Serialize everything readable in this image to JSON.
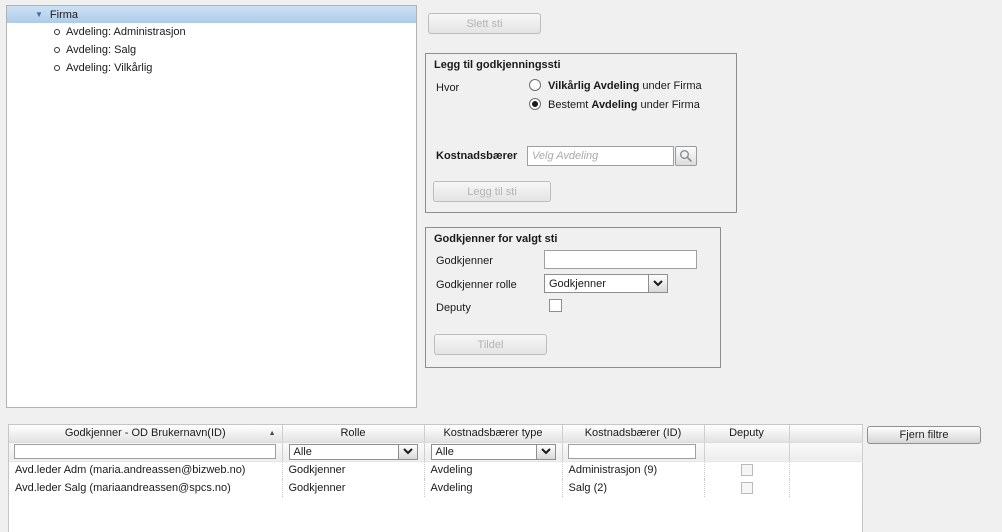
{
  "tree": {
    "root": {
      "label": "Firma",
      "selected": true
    },
    "children": [
      {
        "label": "Avdeling: Administrasjon"
      },
      {
        "label": "Avdeling: Salg"
      },
      {
        "label": "Avdeling: Vilkårlig"
      }
    ]
  },
  "actions": {
    "delete_path_label": "Slett sti"
  },
  "add_panel": {
    "title": "Legg til godkjenningssti",
    "where_label": "Hvor",
    "option1": {
      "bold": "Vilkårlig Avdeling",
      "tail": " under Firma",
      "selected": false
    },
    "option2": {
      "head": "Bestemt ",
      "bold": "Avdeling",
      "tail": " under Firma",
      "selected": true
    },
    "costcarrier_label": "Kostnadsbærer",
    "costcarrier_value": "",
    "costcarrier_placeholder": "Velg Avdeling",
    "add_button_label": "Legg til sti"
  },
  "approver_panel": {
    "title": "Godkjenner for valgt sti",
    "approver_label": "Godkjenner",
    "approver_value": "",
    "role_label": "Godkjenner rolle",
    "role_value": "Godkjenner",
    "deputy_label": "Deputy",
    "deputy_checked": false,
    "assign_button_label": "Tildel"
  },
  "table": {
    "columns": {
      "approver": "Godkjenner - OD Brukernavn(ID)",
      "role": "Rolle",
      "cost_type": "Kostnadsbærer type",
      "cost_id": "Kostnadsbærer (ID)",
      "deputy": "Deputy",
      "extra": ""
    },
    "sort": {
      "column": "approver",
      "direction": "asc"
    },
    "filters": {
      "approver_value": "",
      "role_value": "Alle",
      "cost_type_value": "Alle",
      "cost_id_value": ""
    },
    "rows": [
      {
        "approver": "Avd.leder Adm (maria.andreassen@bizweb.no)",
        "role": "Godkjenner",
        "cost_type": "Avdeling",
        "cost_id": "Administrasjon (9)",
        "deputy_checked": false
      },
      {
        "approver": "Avd.leder Salg (mariaandreassen@spcs.no)",
        "role": "Godkjenner",
        "cost_type": "Avdeling",
        "cost_id": "Salg (2)",
        "deputy_checked": false
      }
    ],
    "clear_filters_label": "Fjern filtre"
  }
}
